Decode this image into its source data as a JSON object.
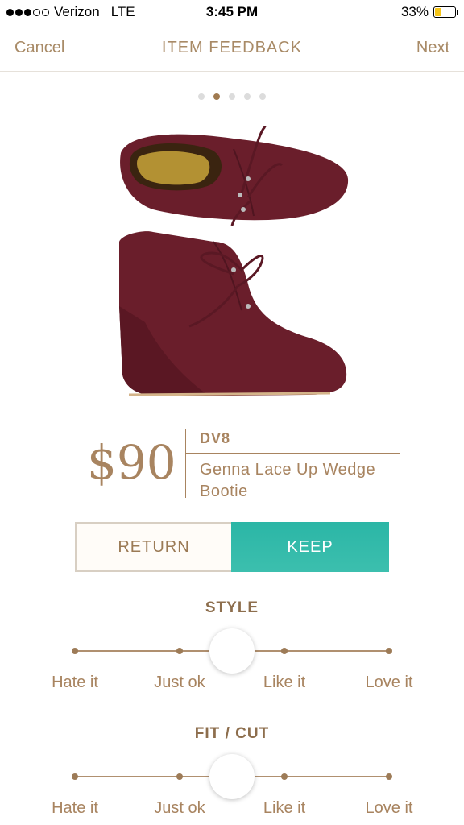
{
  "status": {
    "carrier": "Verizon",
    "network": "LTE",
    "time": "3:45 PM",
    "battery": "33%"
  },
  "nav": {
    "cancel": "Cancel",
    "title": "ITEM FEEDBACK",
    "next": "Next"
  },
  "pager": {
    "count": 5,
    "active": 1
  },
  "product": {
    "price": "$90",
    "brand": "DV8",
    "name": "Genna Lace Up Wedge Bootie",
    "image": "burgundy suede lace-up wedge bootie"
  },
  "buttons": {
    "return": "RETURN",
    "keep": "KEEP"
  },
  "style": {
    "title": "STYLE",
    "labels": [
      "Hate it",
      "Just ok",
      "Like it",
      "Love it"
    ],
    "value": 1.5
  },
  "fit": {
    "title": "FIT / CUT",
    "labels": [
      "Hate it",
      "Just ok",
      "Like it",
      "Love it"
    ],
    "value": 1.5
  },
  "colors": {
    "accent": "#a88460",
    "keep": "#2fb9a8",
    "shoe": "#6b1f2c"
  }
}
